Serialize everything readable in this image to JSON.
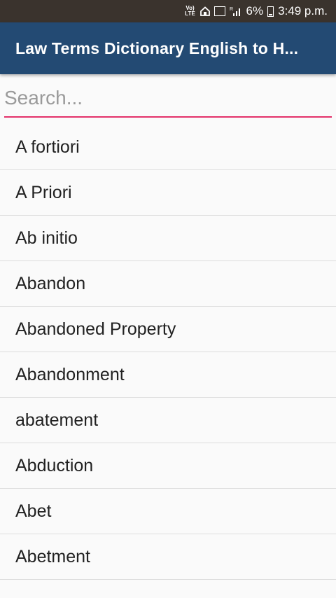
{
  "status_bar": {
    "network": "VoLTE",
    "battery": "6%",
    "time": "3:49 p.m."
  },
  "app_bar": {
    "title": "Law Terms Dictionary English to H..."
  },
  "search": {
    "placeholder": "Search...",
    "value": ""
  },
  "terms": [
    "A fortiori",
    "A Priori",
    "Ab initio",
    "Abandon",
    "Abandoned Property",
    "Abandonment",
    "abatement",
    "Abduction",
    "Abet",
    "Abetment"
  ],
  "colors": {
    "status_bar": "#3a332d",
    "app_bar": "#234a73",
    "search_underline": "#e3306a"
  }
}
